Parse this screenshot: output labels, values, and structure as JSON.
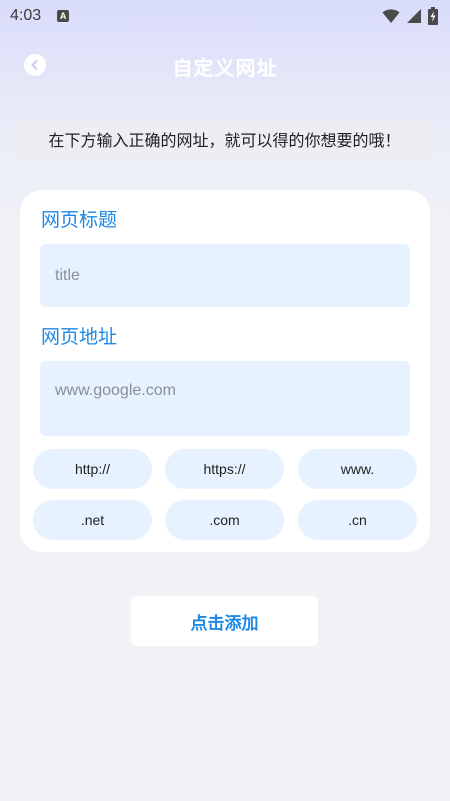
{
  "status_bar": {
    "time": "4:03",
    "notification_badge": "A",
    "icons": [
      "wifi-icon",
      "signal-icon",
      "battery-charging-icon"
    ]
  },
  "header": {
    "title": "自定义网址",
    "back_icon": "chevron-left-icon"
  },
  "hint": "在下方输入正确的网址，就可以得的你想要的哦！",
  "form": {
    "title_label": "网页标题",
    "title_placeholder": "title",
    "url_label": "网页地址",
    "url_placeholder": "www.google.com",
    "chips": [
      "http://",
      "https://",
      "www.",
      ".net",
      ".com",
      ".cn"
    ]
  },
  "add_button": "点击添加",
  "colors": {
    "accent": "#1e88e5",
    "input_bg": "#e6f2ff",
    "card_bg": "#ffffff",
    "page_bg": "#f1f2f6",
    "header_gradient_top": "#d9dcfb"
  }
}
